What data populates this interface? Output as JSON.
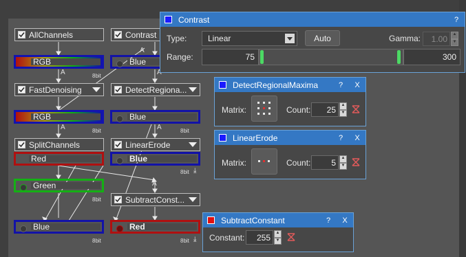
{
  "nodes": {
    "all_channels": "AllChannels",
    "contrast": "Contrast",
    "fast_denoising": "FastDenoising",
    "detect_regional": "DetectRegiona...",
    "split_channels": "SplitChannels",
    "linear_erode": "LinearErode",
    "subtract_const": "SubtractConst..."
  },
  "channels": {
    "rgb1": "RGB",
    "rgb2": "RGB",
    "blue_contrast": "Blue",
    "blue_detect": "Blue",
    "red_split": "Red",
    "blue_erode": "Blue",
    "green": "Green",
    "blue_bottom": "Blue",
    "red_subtract": "Red"
  },
  "bit_label": "8bit",
  "a_label": "A",
  "contrast_panel": {
    "title": "Contrast",
    "help": "?",
    "type_label": "Type:",
    "type_value": "Linear",
    "auto_button": "Auto",
    "gamma_label": "Gamma:",
    "gamma_value": "1.00",
    "range_label": "Range:",
    "range_min": "75",
    "range_max": "300"
  },
  "detect_panel": {
    "title": "DetectRegionalMaxima",
    "help": "?",
    "close": "X",
    "matrix_label": "Matrix:",
    "count_label": "Count:",
    "count_value": "25"
  },
  "erode_panel": {
    "title": "LinearErode",
    "help": "?",
    "close": "X",
    "matrix_label": "Matrix:",
    "count_label": "Count:",
    "count_value": "5"
  },
  "subtract_panel": {
    "title": "SubtractConstant",
    "help": "?",
    "close": "X",
    "constant_label": "Constant:",
    "constant_value": "255"
  },
  "colors": {
    "title_bar": "#3478c4",
    "blue_channel": "#1212a8",
    "red_channel": "#b01010",
    "green_channel": "#14b014",
    "slider_handle": "#4cd964",
    "reset_icon": "#e05a5a"
  }
}
